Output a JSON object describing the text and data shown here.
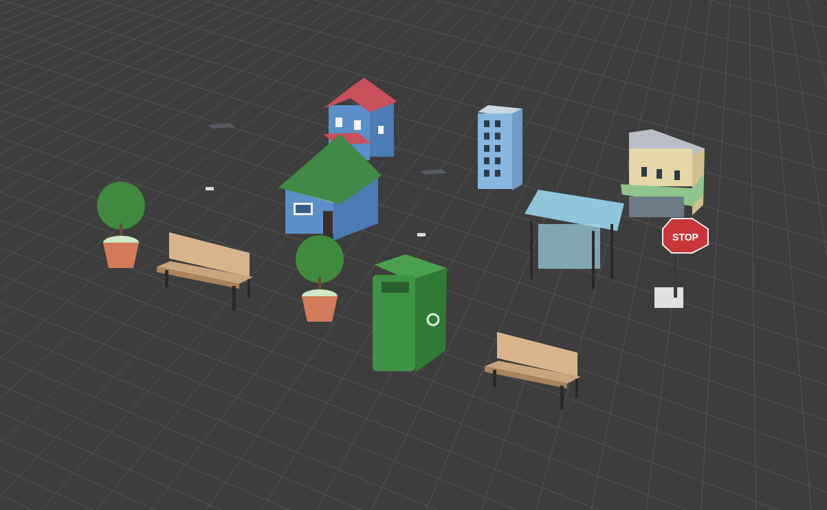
{
  "viewport": {
    "objects": [
      {
        "kind": "house_red"
      },
      {
        "kind": "lamp"
      },
      {
        "kind": "apartment"
      },
      {
        "kind": "shop"
      },
      {
        "kind": "house_green"
      },
      {
        "kind": "lamp"
      },
      {
        "kind": "tree"
      },
      {
        "kind": "bench"
      },
      {
        "kind": "tree"
      },
      {
        "kind": "bin"
      },
      {
        "kind": "shelter"
      },
      {
        "kind": "stop_sign",
        "label": "STOP"
      },
      {
        "kind": "bench"
      }
    ]
  }
}
